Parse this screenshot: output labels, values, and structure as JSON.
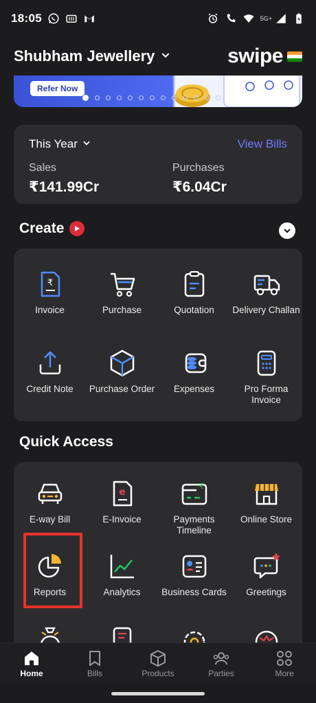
{
  "status_bar": {
    "time": "18:05",
    "network": "5G+",
    "left_icons": [
      "whatsapp-icon",
      "tv-icon",
      "gmail-icon"
    ],
    "right_icons": [
      "alarm-icon",
      "wifi-calling-icon",
      "wifi-icon",
      "signal-icon",
      "battery-icon"
    ]
  },
  "header": {
    "business_name": "Shubham Jewellery",
    "brand": "swipe",
    "flag_icon": "india-flag-icon"
  },
  "banner": {
    "button_label": "Refer Now",
    "carousel_total": 13,
    "carousel_active": 1
  },
  "summary": {
    "period": "This Year",
    "view_bills": "View Bills",
    "sales_label": "Sales",
    "sales_value": "₹141.99Cr",
    "purchases_label": "Purchases",
    "purchases_value": "₹6.04Cr"
  },
  "create": {
    "title": "Create",
    "items": [
      {
        "label": "Invoice",
        "icon": "invoice-icon"
      },
      {
        "label": "Purchase",
        "icon": "cart-icon"
      },
      {
        "label": "Quotation",
        "icon": "quotation-icon"
      },
      {
        "label": "Delivery Challan",
        "icon": "delivery-truck-icon"
      },
      {
        "label": "Credit Note",
        "icon": "credit-note-icon"
      },
      {
        "label": "Purchase Order",
        "icon": "box-icon"
      },
      {
        "label": "Expenses",
        "icon": "wallet-icon"
      },
      {
        "label": "Pro Forma Invoice",
        "icon": "pro-forma-icon"
      }
    ]
  },
  "quick_access": {
    "title": "Quick Access",
    "items": [
      {
        "label": "E-way Bill",
        "icon": "truck-front-icon"
      },
      {
        "label": "E-Invoice",
        "icon": "e-invoice-icon"
      },
      {
        "label": "Payments Timeline",
        "icon": "payments-icon"
      },
      {
        "label": "Online Store",
        "icon": "store-icon"
      },
      {
        "label": "Reports",
        "icon": "pie-chart-icon"
      },
      {
        "label": "Analytics",
        "icon": "line-chart-icon"
      },
      {
        "label": "Business Cards",
        "icon": "business-card-icon"
      },
      {
        "label": "Greetings",
        "icon": "greetings-icon"
      }
    ],
    "highlight_color": "#e8332b"
  },
  "bottom_nav": [
    {
      "label": "Home",
      "icon": "home-icon",
      "active": true
    },
    {
      "label": "Bills",
      "icon": "bookmark-icon",
      "active": false
    },
    {
      "label": "Products",
      "icon": "cube-icon",
      "active": false
    },
    {
      "label": "Parties",
      "icon": "parties-icon",
      "active": false
    },
    {
      "label": "More",
      "icon": "more-grid-icon",
      "active": false
    }
  ],
  "colors": {
    "background": "#1c1c1e",
    "card": "#2c2c2e",
    "accent": "#6b7cff",
    "icon_blue": "#4f8cff",
    "icon_orange": "#f5b431",
    "icon_red": "#e0444e",
    "icon_green": "#22c55e"
  }
}
